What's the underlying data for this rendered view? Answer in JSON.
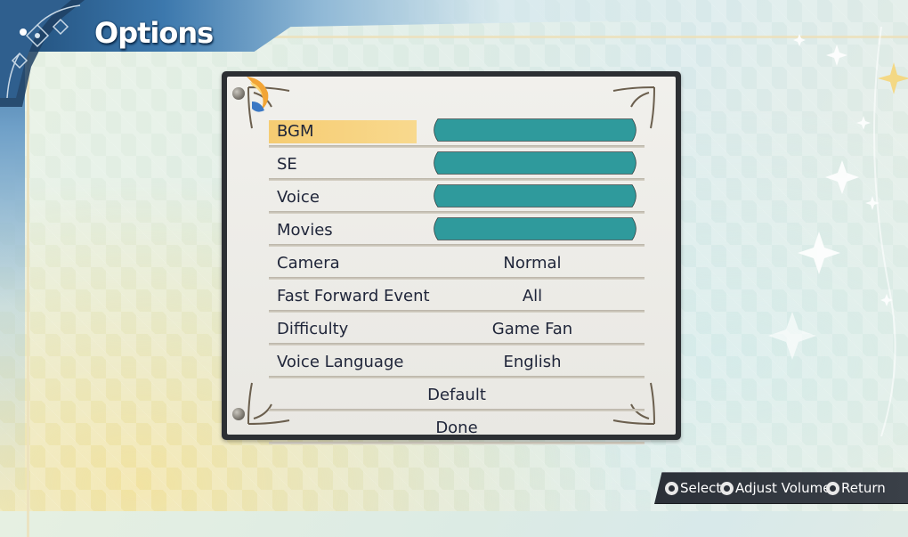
{
  "screen": {
    "title": "Options"
  },
  "menu": {
    "selected_index": 0,
    "items": [
      {
        "label": "BGM",
        "type": "slider",
        "level": 1.0
      },
      {
        "label": "SE",
        "type": "slider",
        "level": 1.0
      },
      {
        "label": "Voice",
        "type": "slider",
        "level": 1.0
      },
      {
        "label": "Movies",
        "type": "slider",
        "level": 1.0
      },
      {
        "label": "Camera",
        "type": "value",
        "value": "Normal"
      },
      {
        "label": "Fast Forward Event",
        "type": "value",
        "value": "All"
      },
      {
        "label": "Difficulty",
        "type": "value",
        "value": "Game Fan"
      },
      {
        "label": "Voice Language",
        "type": "value",
        "value": "English"
      }
    ],
    "actions": [
      {
        "label": "Default"
      },
      {
        "label": "Done"
      }
    ]
  },
  "footer": {
    "hints": [
      {
        "icon": "dpad-icon",
        "label": "Select"
      },
      {
        "icon": "dpad-icon",
        "label": "Adjust Volume"
      },
      {
        "icon": "circle-button-icon",
        "label": "Return"
      }
    ]
  },
  "colors": {
    "slider_fill": "#2f9a9c",
    "selection": "#f6cc72",
    "panel_frame": "#2c2f33",
    "text": "#20263a"
  }
}
